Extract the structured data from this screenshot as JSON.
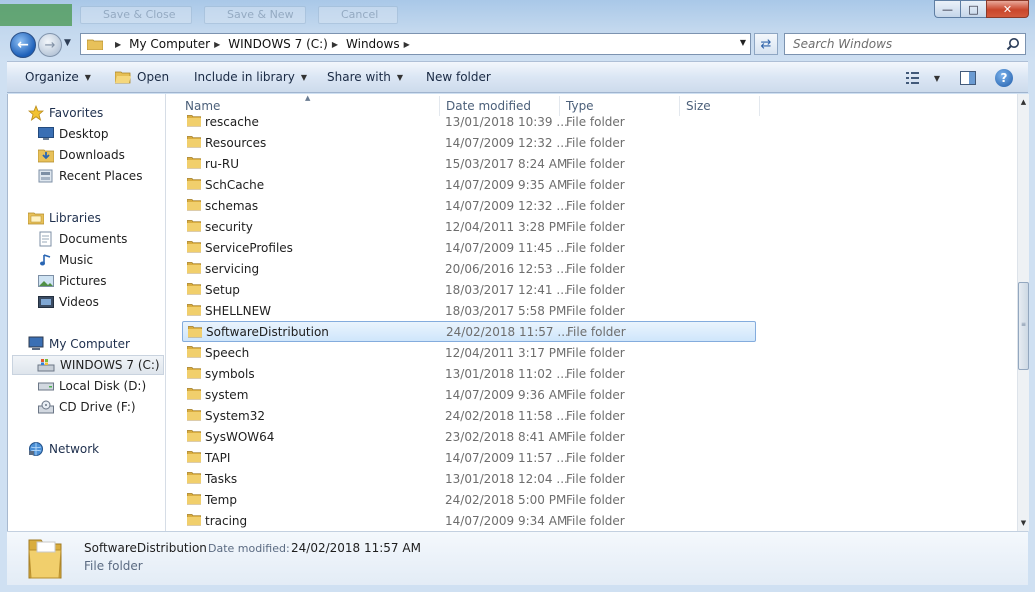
{
  "ghost_toolbar": [
    "Save & Close",
    "Save & New",
    "Cancel"
  ],
  "window_buttons": {
    "minimize": "—",
    "maximize": "□",
    "close": "✕"
  },
  "address": {
    "crumbs": [
      "My Computer",
      "WINDOWS 7 (C:)",
      "Windows"
    ]
  },
  "search": {
    "placeholder": "Search Windows"
  },
  "commands": {
    "organize": "Organize",
    "open": "Open",
    "include": "Include in library",
    "share": "Share with",
    "new_folder": "New folder"
  },
  "nav": {
    "favorites": "Favorites",
    "desktop": "Desktop",
    "downloads": "Downloads",
    "recent": "Recent Places",
    "libraries": "Libraries",
    "documents": "Documents",
    "music": "Music",
    "pictures": "Pictures",
    "videos": "Videos",
    "computer": "My Computer",
    "drive_c": "WINDOWS 7 (C:)",
    "drive_d": "Local Disk (D:)",
    "drive_f": "CD Drive (F:)",
    "network": "Network"
  },
  "columns": {
    "name": "Name",
    "date": "Date modified",
    "type": "Type",
    "size": "Size"
  },
  "files": [
    {
      "name": "rescache",
      "date": "13/01/2018 10:39 ...",
      "type": "File folder"
    },
    {
      "name": "Resources",
      "date": "14/07/2009 12:32 ...",
      "type": "File folder"
    },
    {
      "name": "ru-RU",
      "date": "15/03/2017 8:24 AM",
      "type": "File folder"
    },
    {
      "name": "SchCache",
      "date": "14/07/2009 9:35 AM",
      "type": "File folder"
    },
    {
      "name": "schemas",
      "date": "14/07/2009 12:32 ...",
      "type": "File folder"
    },
    {
      "name": "security",
      "date": "12/04/2011 3:28 PM",
      "type": "File folder"
    },
    {
      "name": "ServiceProfiles",
      "date": "14/07/2009 11:45 ...",
      "type": "File folder"
    },
    {
      "name": "servicing",
      "date": "20/06/2016 12:53 ...",
      "type": "File folder"
    },
    {
      "name": "Setup",
      "date": "18/03/2017 12:41 ...",
      "type": "File folder"
    },
    {
      "name": "SHELLNEW",
      "date": "18/03/2017 5:58 PM",
      "type": "File folder"
    },
    {
      "name": "SoftwareDistribution",
      "date": "24/02/2018 11:57 ...",
      "type": "File folder"
    },
    {
      "name": "Speech",
      "date": "12/04/2011 3:17 PM",
      "type": "File folder"
    },
    {
      "name": "symbols",
      "date": "13/01/2018 11:02 ...",
      "type": "File folder"
    },
    {
      "name": "system",
      "date": "14/07/2009 9:36 AM",
      "type": "File folder"
    },
    {
      "name": "System32",
      "date": "24/02/2018 11:58 ...",
      "type": "File folder"
    },
    {
      "name": "SysWOW64",
      "date": "23/02/2018 8:41 AM",
      "type": "File folder"
    },
    {
      "name": "TAPI",
      "date": "14/07/2009 11:57 ...",
      "type": "File folder"
    },
    {
      "name": "Tasks",
      "date": "13/01/2018 12:04 ...",
      "type": "File folder"
    },
    {
      "name": "Temp",
      "date": "24/02/2018 5:00 PM",
      "type": "File folder"
    },
    {
      "name": "tracing",
      "date": "14/07/2009 9:34 AM",
      "type": "File folder"
    }
  ],
  "selected_index": 10,
  "details": {
    "name": "SoftwareDistribution",
    "date_label": "Date modified:",
    "date_value": "24/02/2018 11:57 AM",
    "type": "File folder"
  }
}
